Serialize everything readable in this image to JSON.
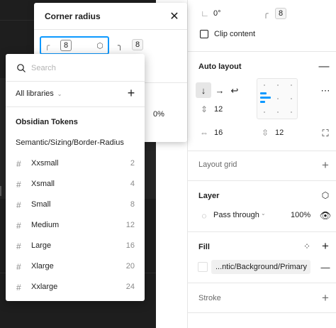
{
  "props": {
    "rotation_value": "0°",
    "corner_value": "8",
    "clip_content_label": "Clip content"
  },
  "auto_layout": {
    "title": "Auto layout",
    "gap_vertical": "12",
    "padding_horizontal": "16",
    "padding_vertical": "12"
  },
  "layout_grid": {
    "title": "Layout grid"
  },
  "layer": {
    "title": "Layer",
    "blend_mode": "Pass through",
    "opacity": "100%"
  },
  "fill": {
    "title": "Fill",
    "variable": "...ntic/Background/Primary"
  },
  "stroke": {
    "title": "Stroke"
  },
  "popup": {
    "title": "Corner radius",
    "radius_value": "8",
    "second_value": "8",
    "opacity_value": "0%"
  },
  "picker": {
    "search_placeholder": "Search",
    "library": "All libraries",
    "group_title": "Obsidian Tokens",
    "group_path": "Semantic/Sizing/Border-Radius",
    "tokens": [
      {
        "name": "Xxsmall",
        "value": "2"
      },
      {
        "name": "Xsmall",
        "value": "4"
      },
      {
        "name": "Small",
        "value": "8"
      },
      {
        "name": "Medium",
        "value": "12"
      },
      {
        "name": "Large",
        "value": "16"
      },
      {
        "name": "Xlarge",
        "value": "20"
      },
      {
        "name": "Xxlarge",
        "value": "24"
      }
    ]
  },
  "colors": {
    "accent": "#0d99ff",
    "canvas": "#1e1e1e"
  }
}
